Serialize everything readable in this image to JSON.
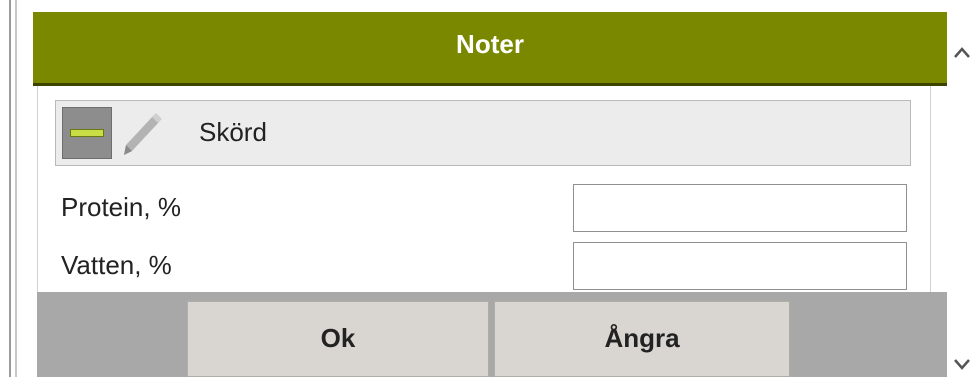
{
  "dialog": {
    "title": "Noter",
    "header_color": "#7a8800"
  },
  "section": {
    "title": "Skörd",
    "collapse_icon": "minus-icon",
    "edit_icon": "pencil-icon"
  },
  "fields": [
    {
      "label": "Protein, %",
      "value": "",
      "placeholder": ""
    },
    {
      "label": "Vatten, %",
      "value": "",
      "placeholder": ""
    }
  ],
  "buttons": {
    "ok_label": "Ok",
    "undo_label": "Ångra"
  },
  "scrollbar": {
    "up_icon": "chevron-up-icon",
    "down_icon": "chevron-down-icon"
  }
}
